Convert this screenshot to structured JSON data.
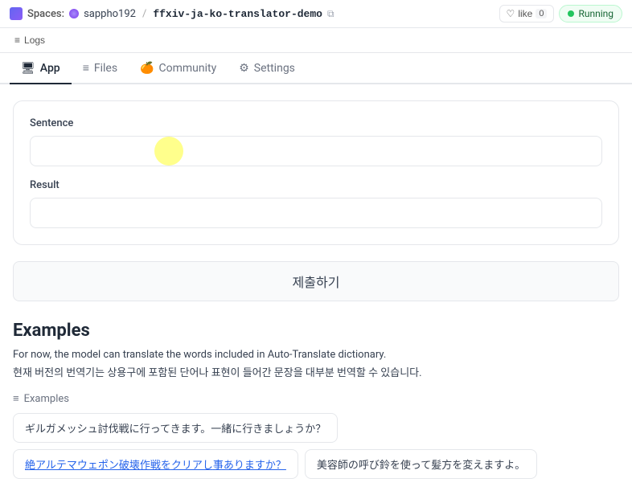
{
  "topbar": {
    "spaces_label": "Spaces:",
    "user": "sappho192",
    "repo": "ffxiv-ja-ko-translator-demo",
    "like_label": "like",
    "like_count": "0",
    "running_label": "Running"
  },
  "logs": {
    "label": "Logs"
  },
  "tabs": [
    {
      "id": "app",
      "label": "App",
      "icon": "🖥",
      "active": true
    },
    {
      "id": "files",
      "label": "Files",
      "icon": "≡",
      "active": false
    },
    {
      "id": "community",
      "label": "Community",
      "icon": "🍊",
      "active": false
    },
    {
      "id": "settings",
      "label": "Settings",
      "icon": "⚙",
      "active": false
    }
  ],
  "form": {
    "sentence_label": "Sentence",
    "sentence_placeholder": "",
    "result_label": "Result",
    "result_placeholder": "",
    "submit_label": "제출하기"
  },
  "examples": {
    "heading": "Examples",
    "desc_en": "For now, the model can translate the words included in Auto-Translate dictionary.",
    "desc_ko": "현재 버전의 번역기는 상용구에 포함된 단어나 표현이 들어간 문장을 대부분 번역할 수 있습니다.",
    "subheader": "Examples",
    "chips": [
      [
        {
          "text": "ギルガメッシュ討伐戦に行ってきます。一緒に行きましょうか？",
          "has_blue": false
        }
      ],
      [
        {
          "text": "絶アルテマウェポン破壊作戦をクリアし事ありますか？",
          "has_blue": true,
          "blue_parts": [
            "絶アルテマウェポン破壊作戦を",
            "クリアし",
            "事ありますか？"
          ]
        },
        {
          "text": "美容師の呼び鈴を使って髪方を変えますよ。",
          "has_blue": false
        }
      ]
    ]
  }
}
